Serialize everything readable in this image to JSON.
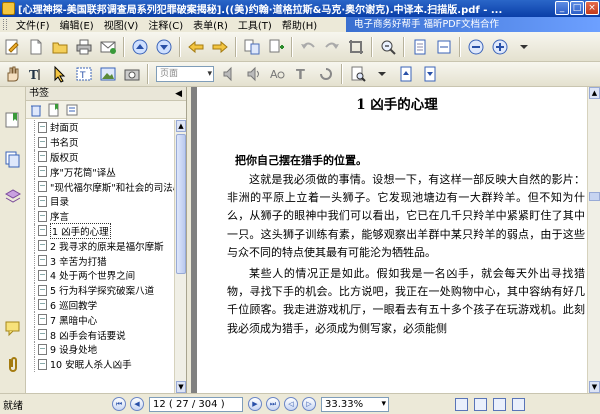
{
  "window": {
    "title": "[心理神探-美国联邦调查局系列犯罪破案揭秘].((美)约翰·道格拉斯&马克·奥尔谢克).中译本.扫描版.pdf - ..."
  },
  "menu": {
    "items": [
      "文件(F)",
      "编辑(E)",
      "视图(V)",
      "注释(C)",
      "表单(R)",
      "工具(T)",
      "帮助(H)"
    ],
    "ad": "电子商务好帮手  福昕PDF文档合作"
  },
  "toolbar": {
    "zoom_placeholder": "页面"
  },
  "bookmark_panel": {
    "header": "书签",
    "collapse_icon": "◀",
    "items": [
      "封面页",
      "书名页",
      "版权页",
      "序\"万花筒\"译丛",
      "\"现代福尔摩斯\"和社会的司法心",
      "目录",
      "序言",
      "1 凶手的心理",
      "2 我寻求的原来是福尔摩斯",
      "3 辛苦为打猎",
      "4 处于两个世界之间",
      "5 行为科学探究破案八道",
      "6 巡回教学",
      "7 黑暗中心",
      "8 凶手会有话要说",
      "9 设身处地",
      "10 安眠人杀人凶手"
    ],
    "selected_index": 7
  },
  "document": {
    "chapter_title": "1   凶手的心理",
    "section_title": "把你自己摆在猎手的位置。",
    "paragraphs": [
      "这就是我必须做的事情。设想一下，有这样一部反映大自然的影片：非洲的平原上立着一头狮子。它发现池塘边有一大群羚羊。但不知为什么，从狮子的眼神中我们可以看出，它已在几千只羚羊中紧紧盯住了其中一只。这头狮子训练有素，能够观察出羊群中某只羚羊的弱点，由于这些与众不同的特点使其最有可能沦为牺牲品。",
      "某些人的情况正是如此。假如我是一名凶手，就会每天外出寻找猎物，寻找下手的机会。比方说吧，我正在一处购物中心，其中容纳有好几千位顾客。我走进游戏机厅，一眼看去有五十多个孩子在玩游戏机。此刻我必须成为猎手，必须成为侧写家，必须能侧"
    ]
  },
  "statusbar": {
    "status": "就绪",
    "page_display": "12  ( 27 / 304 )",
    "zoom": "33.33%"
  }
}
